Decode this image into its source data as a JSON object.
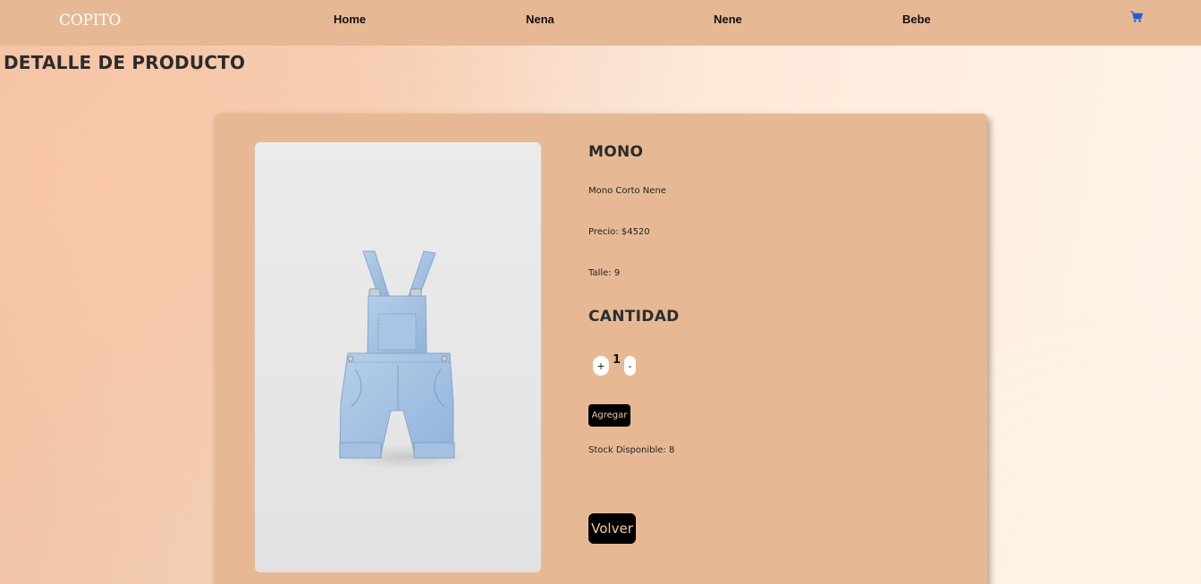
{
  "navbar": {
    "brand": "COPITO",
    "links": [
      "Home",
      "Nena",
      "Nene",
      "Bebe"
    ],
    "cart_icon": "shopping-cart-icon",
    "cart_color": "#1a5fd6"
  },
  "page": {
    "title": "DETALLE DE PRODUCTO"
  },
  "product": {
    "name": "MONO",
    "description": "Mono Corto Nene",
    "price": "Precio: $4520",
    "size": "Talle: 9",
    "image_icon": "denim-overalls-image"
  },
  "quantity": {
    "heading": "CANTIDAD",
    "plus": "+",
    "value": "1",
    "minus": "-"
  },
  "actions": {
    "add": "Agregar",
    "stock": "Stock Disponible: 8",
    "back": "Volver"
  },
  "colors": {
    "navbar": "#e6b994",
    "card": "#e6b994",
    "button_bg": "#000000",
    "button_text": "#f2c8a6"
  }
}
